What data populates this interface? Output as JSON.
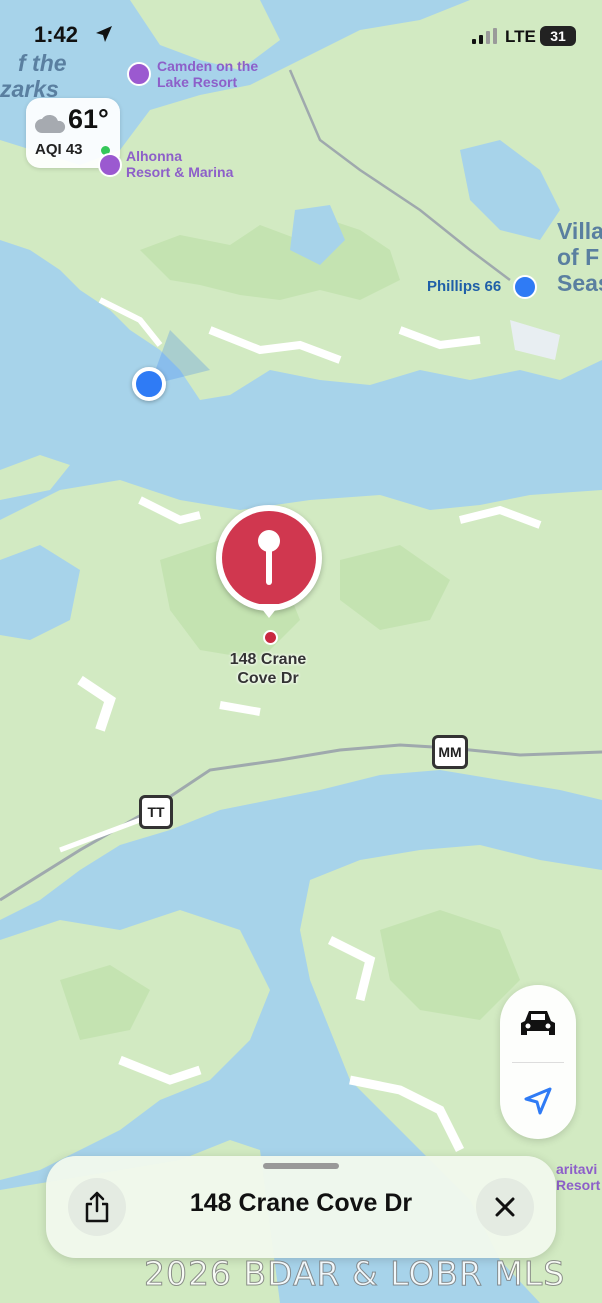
{
  "status_bar": {
    "time": "1:42",
    "network": "LTE",
    "battery": "31"
  },
  "weather": {
    "temperature": "61°",
    "aqi": "AQI 43",
    "aqi_color": "#34c759"
  },
  "map": {
    "pois": {
      "camden": "Camden on the\nLake Resort",
      "alhonna": "Alhonna\nResort & Marina",
      "phillips": "Phillips 66",
      "paritavi": "aritavi\nResort"
    },
    "place_labels": {
      "ozarks_top": "f the",
      "ozarks": "zarks",
      "village": "Villa\nof F\nSeas"
    },
    "shields": {
      "mm": "MM",
      "tt": "TT"
    },
    "pin_label": "148 Crane\nCove Dr"
  },
  "sheet": {
    "title": "148 Crane Cove Dr"
  },
  "watermark": "2026 BDAR & LOBR MLS",
  "colors": {
    "water": "#a7d3ea",
    "land": "#d2eac2",
    "pin": "#d0374f",
    "user_location": "#2f7bf5"
  }
}
